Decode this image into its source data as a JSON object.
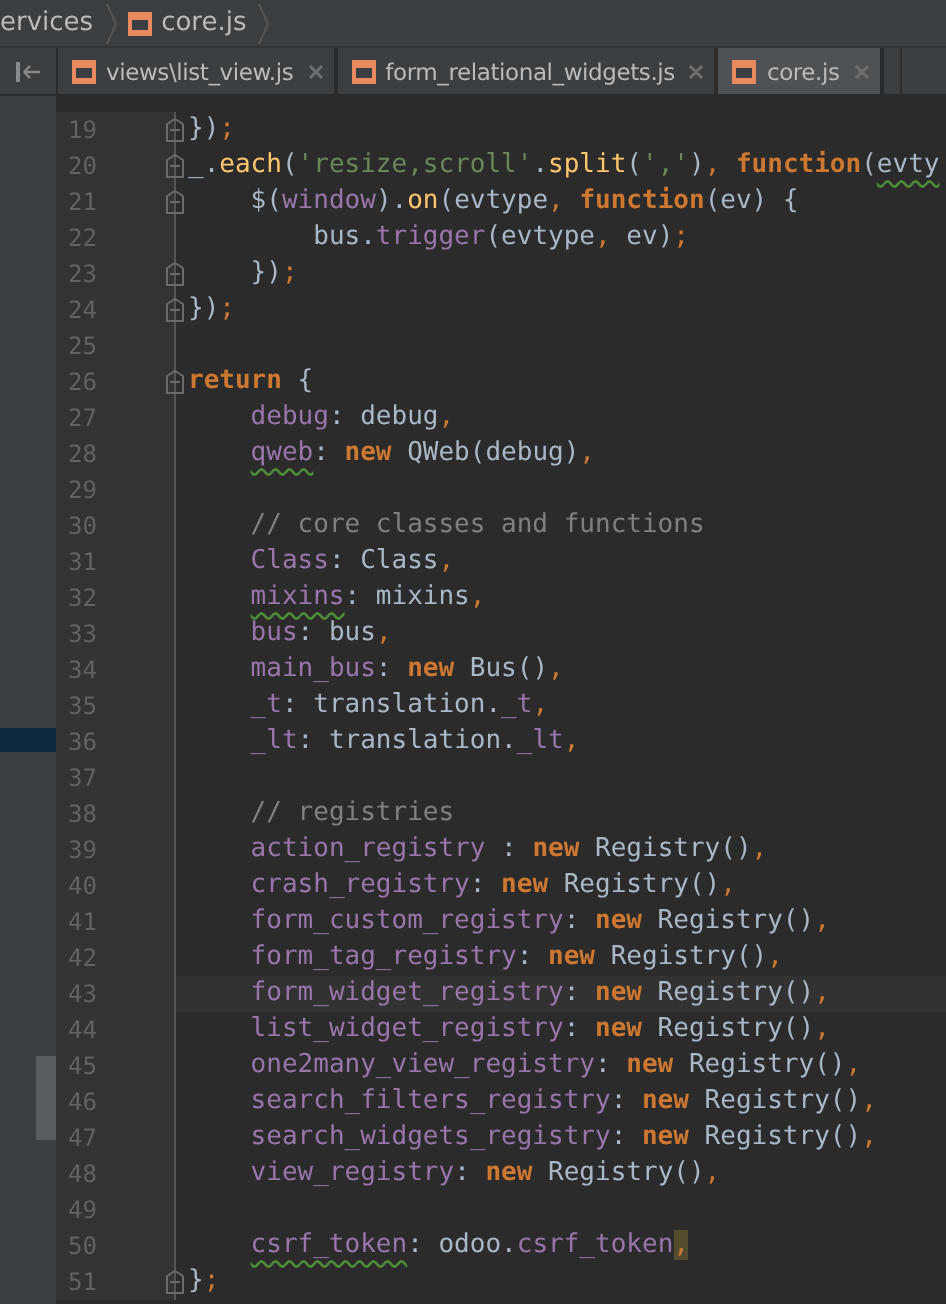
{
  "breadcrumb": [
    {
      "label": "ervices"
    },
    {
      "label": "core.js",
      "file_icon": true
    }
  ],
  "tabs": [
    {
      "label": "views\\list_view.js",
      "selected": false
    },
    {
      "label": "form_relational_widgets.js",
      "selected": false
    },
    {
      "label": "core.js",
      "selected": true
    }
  ],
  "lines": [
    {
      "number": "19",
      "fold": true,
      "tokens": [
        {
          "kind": "id",
          "text": "})"
        },
        {
          "kind": "pun",
          "text": ";"
        }
      ]
    },
    {
      "number": "20",
      "fold": true,
      "tokens": [
        {
          "kind": "id",
          "text": "_."
        },
        {
          "kind": "fn",
          "text": "each"
        },
        {
          "kind": "id",
          "text": "("
        },
        {
          "kind": "str",
          "text": "'resize,scroll'"
        },
        {
          "kind": "id",
          "text": "."
        },
        {
          "kind": "fn",
          "text": "split"
        },
        {
          "kind": "id",
          "text": "("
        },
        {
          "kind": "str",
          "text": "','"
        },
        {
          "kind": "id",
          "text": ")"
        },
        {
          "kind": "pun",
          "text": ", "
        },
        {
          "kind": "kw",
          "text": "function"
        },
        {
          "kind": "id",
          "text": "("
        },
        {
          "kind": "id",
          "text": "evty",
          "squiggle": true
        }
      ]
    },
    {
      "number": "21",
      "fold": true,
      "tokens": [
        {
          "kind": "id",
          "text": "    $("
        },
        {
          "kind": "prop",
          "text": "window"
        },
        {
          "kind": "id",
          "text": ")."
        },
        {
          "kind": "fn",
          "text": "on"
        },
        {
          "kind": "id",
          "text": "(evtype"
        },
        {
          "kind": "pun",
          "text": ", "
        },
        {
          "kind": "kw",
          "text": "function"
        },
        {
          "kind": "id",
          "text": "(ev) {"
        }
      ]
    },
    {
      "number": "22",
      "tokens": [
        {
          "kind": "id",
          "text": "        bus."
        },
        {
          "kind": "prop",
          "text": "trigger"
        },
        {
          "kind": "id",
          "text": "(evtype"
        },
        {
          "kind": "pun",
          "text": ", "
        },
        {
          "kind": "id",
          "text": "ev)"
        },
        {
          "kind": "pun",
          "text": ";"
        }
      ]
    },
    {
      "number": "23",
      "fold": true,
      "tokens": [
        {
          "kind": "id",
          "text": "    })"
        },
        {
          "kind": "pun",
          "text": ";"
        }
      ]
    },
    {
      "number": "24",
      "fold": true,
      "tokens": [
        {
          "kind": "id",
          "text": "})"
        },
        {
          "kind": "pun",
          "text": ";"
        }
      ]
    },
    {
      "number": "25"
    },
    {
      "number": "26",
      "fold": true,
      "tokens": [
        {
          "kind": "kw",
          "text": "return"
        },
        {
          "kind": "id",
          "text": " {"
        }
      ]
    },
    {
      "number": "27",
      "tokens": [
        {
          "kind": "prop",
          "text": "    debug"
        },
        {
          "kind": "id",
          "text": ": debug"
        },
        {
          "kind": "pun",
          "text": ","
        }
      ]
    },
    {
      "number": "28",
      "indented": true,
      "tokens": [
        {
          "kind": "prop",
          "text": "qweb",
          "squiggle": true
        },
        {
          "kind": "id",
          "text": ": "
        },
        {
          "kind": "kw",
          "text": "new"
        },
        {
          "kind": "id",
          "text": " QWeb(debug)"
        },
        {
          "kind": "pun",
          "text": ","
        }
      ]
    },
    {
      "number": "29"
    },
    {
      "number": "30",
      "tokens": [
        {
          "kind": "cmt",
          "text": "    // core classes and functions"
        }
      ]
    },
    {
      "number": "31",
      "tokens": [
        {
          "kind": "prop",
          "text": "    Class"
        },
        {
          "kind": "id",
          "text": ": Class"
        },
        {
          "kind": "pun",
          "text": ","
        }
      ]
    },
    {
      "number": "32",
      "indented": true,
      "tokens": [
        {
          "kind": "prop",
          "text": "mixins",
          "squiggle": true
        },
        {
          "kind": "id",
          "text": ": mixins"
        },
        {
          "kind": "pun",
          "text": ","
        }
      ]
    },
    {
      "number": "33",
      "tokens": [
        {
          "kind": "prop",
          "text": "    bus"
        },
        {
          "kind": "id",
          "text": ": bus"
        },
        {
          "kind": "pun",
          "text": ","
        }
      ]
    },
    {
      "number": "34",
      "tokens": [
        {
          "kind": "prop",
          "text": "    main_bus"
        },
        {
          "kind": "id",
          "text": ": "
        },
        {
          "kind": "kw",
          "text": "new"
        },
        {
          "kind": "id",
          "text": " Bus()"
        },
        {
          "kind": "pun",
          "text": ","
        }
      ]
    },
    {
      "number": "35",
      "tokens": [
        {
          "kind": "prop",
          "text": "    _t"
        },
        {
          "kind": "id",
          "text": ": translation."
        },
        {
          "kind": "prop",
          "text": "_t"
        },
        {
          "kind": "pun",
          "text": ","
        }
      ]
    },
    {
      "number": "36",
      "tokens": [
        {
          "kind": "prop",
          "text": "    _lt"
        },
        {
          "kind": "id",
          "text": ": translation."
        },
        {
          "kind": "prop",
          "text": "_lt"
        },
        {
          "kind": "pun",
          "text": ","
        }
      ]
    },
    {
      "number": "37"
    },
    {
      "number": "38",
      "tokens": [
        {
          "kind": "cmt",
          "text": "    // registries"
        }
      ]
    },
    {
      "number": "39",
      "tokens": [
        {
          "kind": "prop",
          "text": "    action_registry"
        },
        {
          "kind": "id",
          "text": " : "
        },
        {
          "kind": "kw",
          "text": "new"
        },
        {
          "kind": "id",
          "text": " Registry()"
        },
        {
          "kind": "pun",
          "text": ","
        }
      ]
    },
    {
      "number": "40",
      "tokens": [
        {
          "kind": "prop",
          "text": "    crash_registry"
        },
        {
          "kind": "id",
          "text": ": "
        },
        {
          "kind": "kw",
          "text": "new"
        },
        {
          "kind": "id",
          "text": " Registry()"
        },
        {
          "kind": "pun",
          "text": ","
        }
      ]
    },
    {
      "number": "41",
      "tokens": [
        {
          "kind": "prop",
          "text": "    form_custom_registry"
        },
        {
          "kind": "id",
          "text": ": "
        },
        {
          "kind": "kw",
          "text": "new"
        },
        {
          "kind": "id",
          "text": " Registry()"
        },
        {
          "kind": "pun",
          "text": ","
        }
      ]
    },
    {
      "number": "42",
      "tokens": [
        {
          "kind": "prop",
          "text": "    form_tag_registry"
        },
        {
          "kind": "id",
          "text": ": "
        },
        {
          "kind": "kw",
          "text": "new"
        },
        {
          "kind": "id",
          "text": " Registry()"
        },
        {
          "kind": "pun",
          "text": ","
        }
      ]
    },
    {
      "number": "43",
      "current": true,
      "tokens": [
        {
          "kind": "prop",
          "text": "    form_widget_registry"
        },
        {
          "kind": "id",
          "text": ": "
        },
        {
          "kind": "kw",
          "text": "new"
        },
        {
          "kind": "id",
          "text": " Registry()"
        },
        {
          "kind": "pun",
          "text": ","
        }
      ]
    },
    {
      "number": "44",
      "tokens": [
        {
          "kind": "prop",
          "text": "    list_widget_registry"
        },
        {
          "kind": "id",
          "text": ": "
        },
        {
          "kind": "kw",
          "text": "new"
        },
        {
          "kind": "id",
          "text": " Registry()"
        },
        {
          "kind": "pun",
          "text": ","
        }
      ]
    },
    {
      "number": "45",
      "tokens": [
        {
          "kind": "prop",
          "text": "    one2many_view_registry"
        },
        {
          "kind": "id",
          "text": ": "
        },
        {
          "kind": "kw",
          "text": "new"
        },
        {
          "kind": "id",
          "text": " Registry()"
        },
        {
          "kind": "pun",
          "text": ","
        }
      ]
    },
    {
      "number": "46",
      "tokens": [
        {
          "kind": "prop",
          "text": "    search_filters_registry"
        },
        {
          "kind": "id",
          "text": ": "
        },
        {
          "kind": "kw",
          "text": "new"
        },
        {
          "kind": "id",
          "text": " Registry()"
        },
        {
          "kind": "pun",
          "text": ","
        }
      ]
    },
    {
      "number": "47",
      "tokens": [
        {
          "kind": "prop",
          "text": "    search_widgets_registry"
        },
        {
          "kind": "id",
          "text": ": "
        },
        {
          "kind": "kw",
          "text": "new"
        },
        {
          "kind": "id",
          "text": " Registry()"
        },
        {
          "kind": "pun",
          "text": ","
        }
      ]
    },
    {
      "number": "48",
      "tokens": [
        {
          "kind": "prop",
          "text": "    view_registry"
        },
        {
          "kind": "id",
          "text": ": "
        },
        {
          "kind": "kw",
          "text": "new"
        },
        {
          "kind": "id",
          "text": " Registry()"
        },
        {
          "kind": "pun",
          "text": ","
        }
      ]
    },
    {
      "number": "49"
    },
    {
      "number": "50",
      "indented": true,
      "tokens": [
        {
          "kind": "prop",
          "text": "csrf_token",
          "squiggle": true
        },
        {
          "kind": "id",
          "text": ": odoo."
        },
        {
          "kind": "prop",
          "text": "csrf_token"
        },
        {
          "kind": "pun",
          "text": ",",
          "caret": true
        }
      ]
    },
    {
      "number": "51",
      "fold": true,
      "tokens": [
        {
          "kind": "id",
          "text": "}"
        },
        {
          "kind": "pun",
          "text": ";"
        }
      ]
    }
  ]
}
